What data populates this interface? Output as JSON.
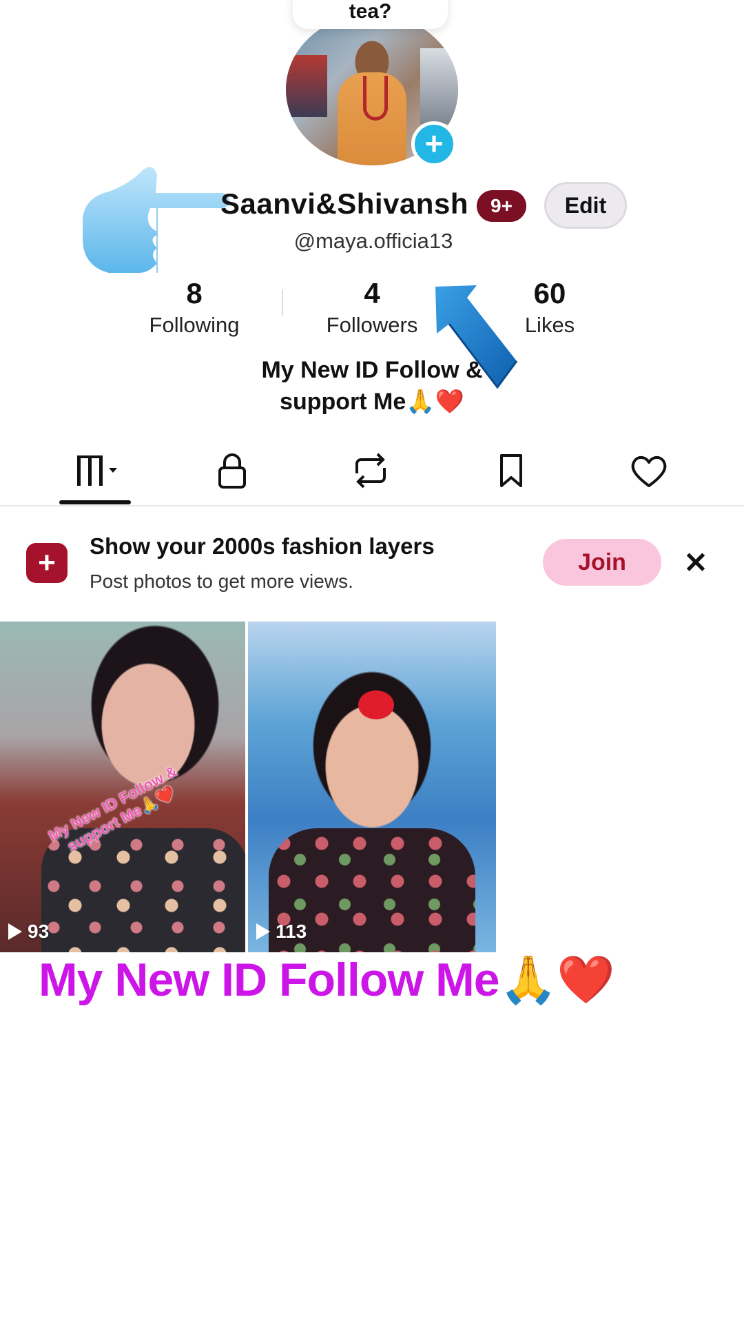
{
  "note": {
    "text": "tea?"
  },
  "profile": {
    "display_name": "Saanvi&Shivansh",
    "badge": "9+",
    "edit_label": "Edit",
    "handle": "@maya.officia13",
    "bio_line1": "My New ID Follow &",
    "bio_line2": "support Me🙏❤️"
  },
  "stats": [
    {
      "value": "8",
      "label": "Following"
    },
    {
      "value": "4",
      "label": "Followers"
    },
    {
      "value": "60",
      "label": "Likes"
    }
  ],
  "tabs": [
    {
      "name": "videos-tab",
      "icon": "grid-icon"
    },
    {
      "name": "private-tab",
      "icon": "lock-icon"
    },
    {
      "name": "reposts-tab",
      "icon": "repost-icon"
    },
    {
      "name": "favorites-tab",
      "icon": "bookmark-icon"
    },
    {
      "name": "liked-tab",
      "icon": "heart-icon"
    }
  ],
  "promo": {
    "title": "Show your 2000s fashion layers",
    "subtitle": "Post photos to get more views.",
    "join_label": "Join",
    "close_symbol": "✕"
  },
  "videos": [
    {
      "views": "93",
      "overlay_text": "My New ID Follow & support Me🙏❤️"
    },
    {
      "views": "113"
    }
  ],
  "caption": "My New ID Follow Me🙏❤️",
  "colors": {
    "accent_pink": "#f9c6dd",
    "brand_red": "#a5122b",
    "caption_magenta": "#cc16e8",
    "plus_blue": "#23b7e6",
    "badge_red": "#7b0f24"
  }
}
